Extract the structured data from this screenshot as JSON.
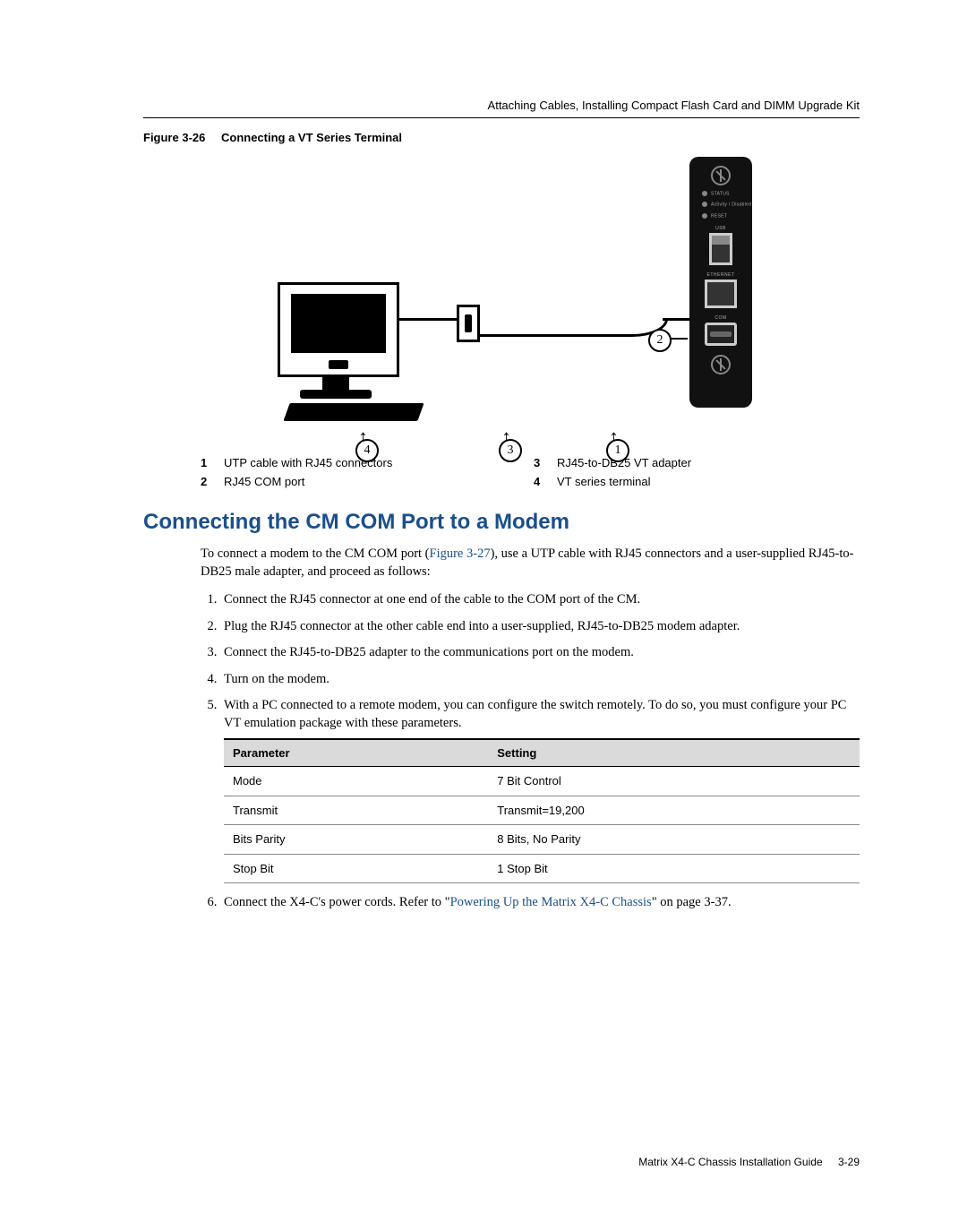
{
  "running_head": "Attaching Cables, Installing Compact Flash Card and DIMM Upgrade Kit",
  "figure": {
    "label": "Figure 3-26",
    "caption": "Connecting a VT Series Terminal",
    "cm_labels": {
      "status": "STATUS",
      "activity": "Activity /\nDisabled",
      "reset": "RESET",
      "usb": "USB",
      "ethernet": "ETHERNET",
      "com": "COM"
    },
    "callouts": {
      "c1": "1",
      "c2": "2",
      "c3": "3",
      "c4": "4"
    }
  },
  "legend": {
    "n1": "1",
    "t1": "UTP cable with RJ45 connectors",
    "n2": "2",
    "t2": "RJ45 COM port",
    "n3": "3",
    "t3": "RJ45-to-DB25 VT adapter",
    "n4": "4",
    "t4": "VT series terminal"
  },
  "section_title": "Connecting the CM COM Port to a Modem",
  "intro_a": "To connect a modem to the CM COM port (",
  "intro_link": "Figure 3-27",
  "intro_b": "), use a UTP cable with RJ45 connectors and a user-supplied RJ45-to-DB25 male adapter, and proceed as follows:",
  "steps": {
    "s1": "Connect the RJ45 connector at one end of the cable to the COM port of the CM.",
    "s2": "Plug the RJ45 connector at the other cable end into a user-supplied, RJ45-to-DB25 modem adapter.",
    "s3": "Connect the RJ45-to-DB25 adapter to the communications port on the modem.",
    "s4": "Turn on the modem.",
    "s5": "With a PC connected to a remote modem, you can configure the switch remotely. To do so, you must configure your PC VT emulation package with these parameters.",
    "s6a": "Connect the X4-C's power cords. Refer to \"",
    "s6link": "Powering Up the Matrix X4-C Chassis",
    "s6b": "\" on page 3-37."
  },
  "table": {
    "h1": "Parameter",
    "h2": "Setting",
    "rows": [
      {
        "p": "Mode",
        "s": "7 Bit Control"
      },
      {
        "p": "Transmit",
        "s": "Transmit=19,200"
      },
      {
        "p": "Bits Parity",
        "s": "8 Bits, No Parity"
      },
      {
        "p": "Stop Bit",
        "s": "1 Stop Bit"
      }
    ]
  },
  "footer": {
    "book": "Matrix X4-C Chassis Installation Guide",
    "page": "3-29"
  }
}
